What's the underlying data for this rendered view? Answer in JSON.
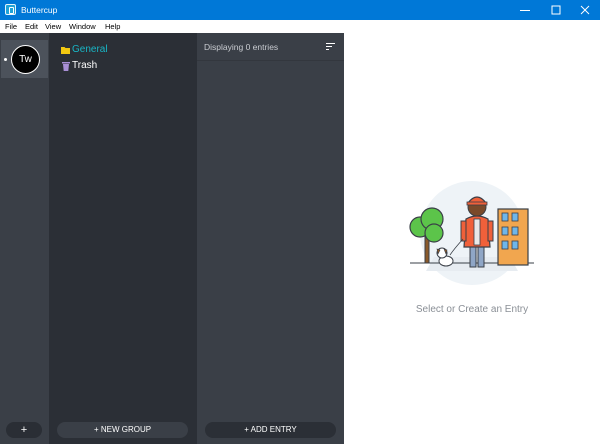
{
  "window": {
    "title": "Buttercup"
  },
  "menu": [
    "File",
    "Edit",
    "View",
    "Window",
    "Help"
  ],
  "vaults": {
    "items": [
      {
        "initials": "Tw"
      }
    ],
    "add_label": "+"
  },
  "groups": {
    "items": [
      {
        "label": "General",
        "icon": "folder-icon",
        "color": "#19b5c5",
        "active": true
      },
      {
        "label": "Trash",
        "icon": "trash-icon",
        "color": "#ffffff",
        "active": false
      }
    ],
    "new_label": "+ NEW GROUP"
  },
  "entries": {
    "count_label": "Displaying 0 entries",
    "add_label": "+ ADD ENTRY"
  },
  "main": {
    "empty_message": "Select or Create an Entry"
  },
  "colors": {
    "accent": "#19b5c5",
    "titlebar": "#0078d7",
    "sidebar_dark": "#2b2f36",
    "sidebar_mid": "#3a3f47"
  }
}
